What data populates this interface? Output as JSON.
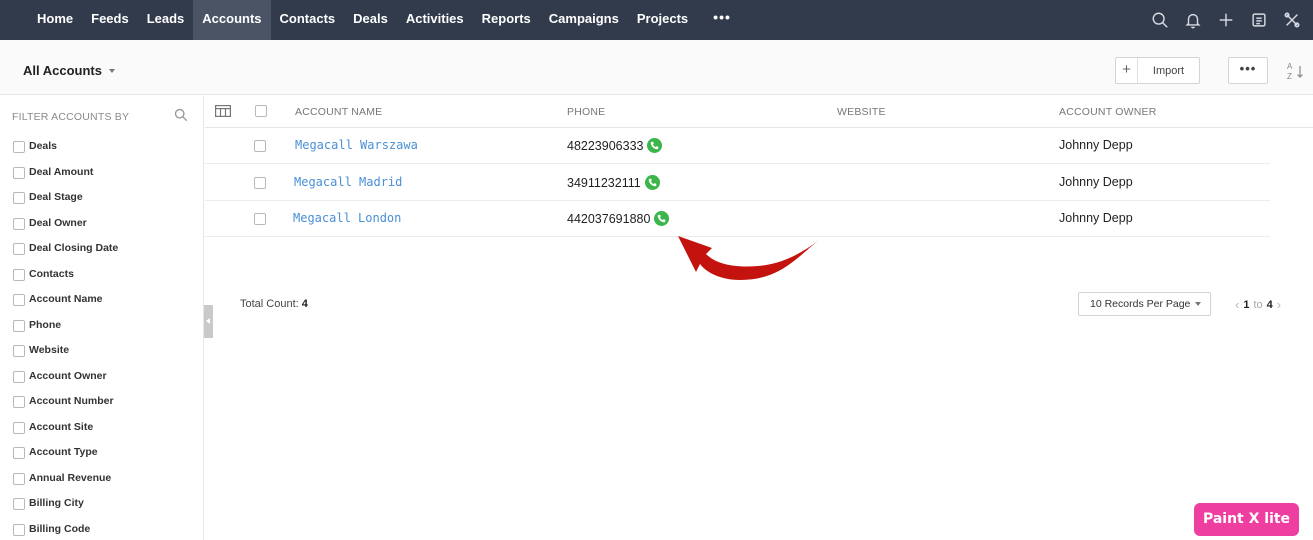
{
  "nav": {
    "items": [
      {
        "label": "Home",
        "active": false
      },
      {
        "label": "Feeds",
        "active": false
      },
      {
        "label": "Leads",
        "active": false
      },
      {
        "label": "Accounts",
        "active": true
      },
      {
        "label": "Contacts",
        "active": false
      },
      {
        "label": "Deals",
        "active": false
      },
      {
        "label": "Activities",
        "active": false
      },
      {
        "label": "Reports",
        "active": false
      },
      {
        "label": "Campaigns",
        "active": false
      },
      {
        "label": "Projects",
        "active": false
      }
    ],
    "more": "•••",
    "icons": [
      "search-icon",
      "bell-icon",
      "plus-icon",
      "calendar-icon",
      "tools-icon"
    ]
  },
  "header": {
    "view": "All Accounts",
    "import_label": "Import",
    "import_plus": "+",
    "more_label": "•••"
  },
  "sidebar": {
    "title": "FILTER ACCOUNTS BY",
    "filters": [
      "Deals",
      "Deal Amount",
      "Deal Stage",
      "Deal Owner",
      "Deal Closing Date",
      "Contacts",
      "Account Name",
      "Phone",
      "Website",
      "Account Owner",
      "Account Number",
      "Account Site",
      "Account Type",
      "Annual Revenue",
      "Billing City",
      "Billing Code"
    ]
  },
  "table": {
    "columns": {
      "account_name": "ACCOUNT NAME",
      "phone": "PHONE",
      "website": "WEBSITE",
      "owner": "ACCOUNT OWNER"
    },
    "rows": [
      {
        "account_name": "Megacall Warszawa",
        "phone": "48223906333",
        "website": "",
        "owner": "Johnny Depp"
      },
      {
        "account_name": "Megacall Madrid",
        "phone": "34911232111",
        "website": "",
        "owner": "Johnny Depp"
      },
      {
        "account_name": "Megacall London",
        "phone": "442037691880",
        "website": "",
        "owner": "Johnny Depp"
      }
    ]
  },
  "footer": {
    "total_label": "Total Count:",
    "total_value": "4",
    "per_page": "10 Records Per Page",
    "page_from": "1",
    "page_to_label": "to",
    "page_to": "4"
  },
  "badge": "Paint X lite",
  "colors": {
    "nav_bg": "#323b4c",
    "nav_active": "#4b5465",
    "link": "#4a8fd6",
    "phone_green": "#3cb54a",
    "arrow_red": "#c4130f",
    "badge": "#ee3fa1"
  }
}
